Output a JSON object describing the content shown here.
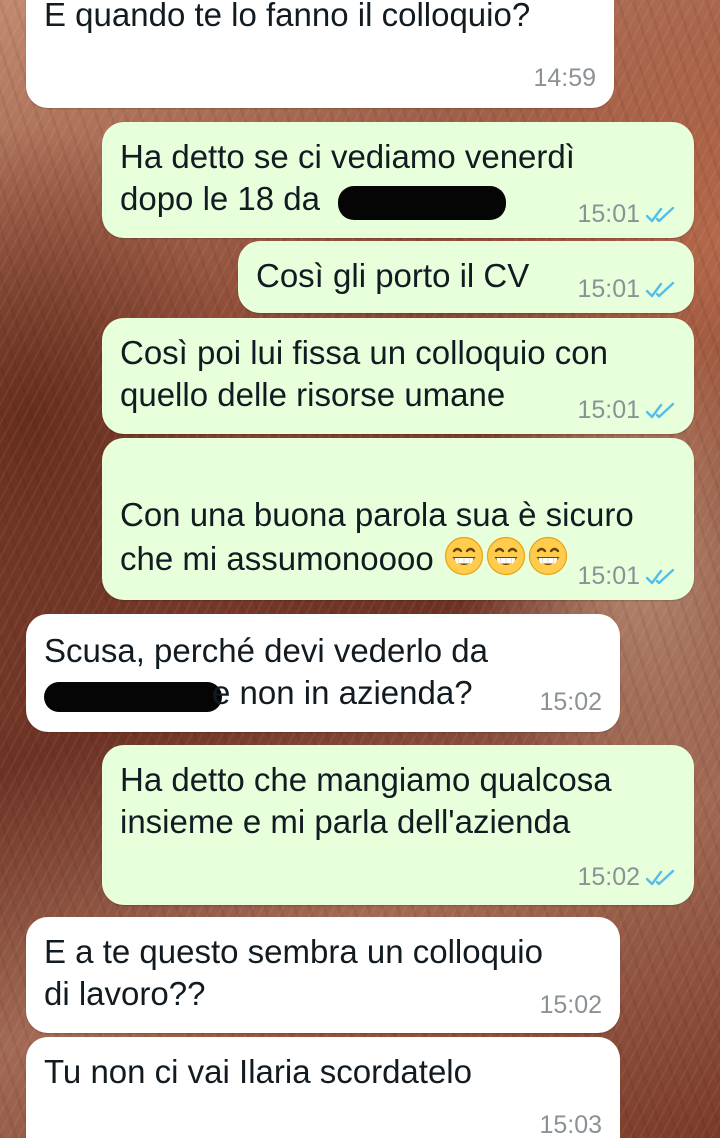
{
  "colors": {
    "incoming_bubble": "#ffffff",
    "outgoing_bubble": "#e7ffdb",
    "read_ticks": "#53bdeb",
    "timestamp": "#8b9296"
  },
  "messages": [
    {
      "direction": "incoming",
      "text": "E quando te lo fanno il colloquio?",
      "time": "14:59"
    },
    {
      "direction": "outgoing",
      "text": "Ha detto se ci vediamo venerdì\ndopo le 18 da",
      "time": "15:01",
      "status": "read",
      "redacted": true
    },
    {
      "direction": "outgoing",
      "text": "Così gli porto il CV",
      "time": "15:01",
      "status": "read"
    },
    {
      "direction": "outgoing",
      "text": "Così poi lui fissa un colloquio con\nquello delle risorse umane",
      "time": "15:01",
      "status": "read"
    },
    {
      "direction": "outgoing",
      "text": "Con una buona parola sua è sicuro\nche mi assumonoooo",
      "emoji": [
        "grinning-face-with-smiling-eyes",
        "grinning-face-with-smiling-eyes",
        "grinning-face-with-smiling-eyes"
      ],
      "time": "15:01",
      "status": "read"
    },
    {
      "direction": "incoming",
      "text_line1": "Scusa, perché devi vederlo da",
      "text_line2": "e non in azienda?",
      "time": "15:02",
      "redacted": true
    },
    {
      "direction": "outgoing",
      "text": "Ha detto che mangiamo qualcosa\ninsieme e mi parla dell'azienda",
      "time": "15:02",
      "status": "read"
    },
    {
      "direction": "incoming",
      "text": "E a te questo sembra un colloquio\ndi lavoro??",
      "time": "15:02"
    },
    {
      "direction": "incoming",
      "text": "Tu non ci vai Ilaria scordatelo",
      "time": "15:03"
    }
  ]
}
